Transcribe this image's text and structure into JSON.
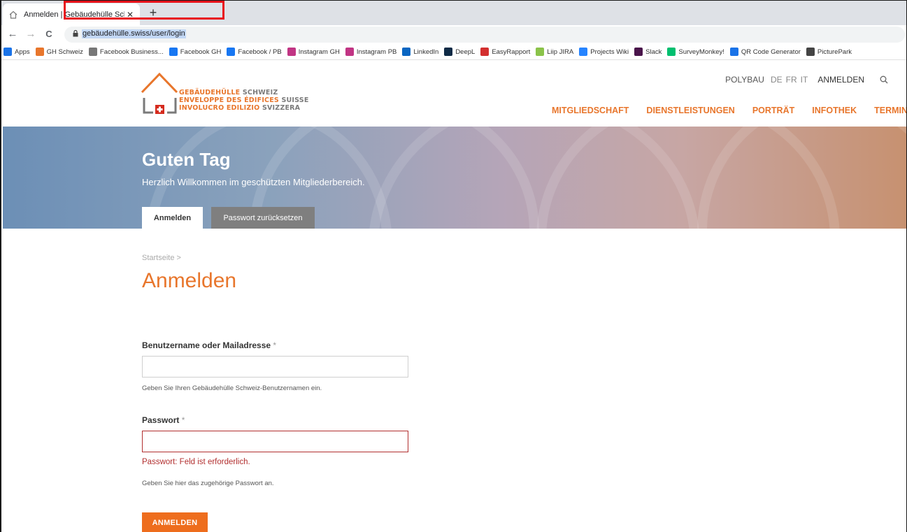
{
  "browser": {
    "tab_title": "Anmelden | Gebäudehülle Schwe",
    "tab_close": "✕",
    "new_tab": "+",
    "url": "gebäudehülle.swiss/user/login",
    "back": "←",
    "forward": "→",
    "reload": "C"
  },
  "bookmarks": [
    {
      "label": "Apps",
      "color": "#1a73e8"
    },
    {
      "label": "GH Schweiz",
      "color": "#e8762c"
    },
    {
      "label": "Facebook Business...",
      "color": "#777777"
    },
    {
      "label": "Facebook GH",
      "color": "#1877f2"
    },
    {
      "label": "Facebook / PB",
      "color": "#1877f2"
    },
    {
      "label": "Instagram GH",
      "color": "#c13584"
    },
    {
      "label": "Instagram PB",
      "color": "#c13584"
    },
    {
      "label": "LinkedIn",
      "color": "#0a66c2"
    },
    {
      "label": "DeepL",
      "color": "#0f2b46"
    },
    {
      "label": "EasyRapport",
      "color": "#d32f2f"
    },
    {
      "label": "Liip JIRA",
      "color": "#8bc34a"
    },
    {
      "label": "Projects Wiki",
      "color": "#2684ff"
    },
    {
      "label": "Slack",
      "color": "#4a154b"
    },
    {
      "label": "SurveyMonkey!",
      "color": "#00bf6f"
    },
    {
      "label": "QR Code Generator",
      "color": "#1a73e8"
    },
    {
      "label": "PicturePark",
      "color": "#444444"
    }
  ],
  "site": {
    "logo_lines": [
      {
        "orange": "GEBÄUDEHÜLLE",
        "grey": " SCHWEIZ"
      },
      {
        "orange": "ENVELOPPE DES ÉDIFICES",
        "grey": " SUISSE"
      },
      {
        "orange": "INVOLUCRO EDILIZIO",
        "grey": " SVIZZERA"
      }
    ],
    "topnav": {
      "polybau": "POLYBAU",
      "de": "DE",
      "fr": "FR",
      "it": "IT",
      "login": "ANMELDEN"
    },
    "mainnav": [
      "MITGLIEDSCHAFT",
      "DIENSTLEISTUNGEN",
      "PORTRÄT",
      "INFOTHEK",
      "TERMINE"
    ],
    "accent": "#e8762c"
  },
  "hero": {
    "title": "Guten Tag",
    "subtitle": "Herzlich Willkommen im geschützten Mitgliederbereich.",
    "tab_login": "Anmelden",
    "tab_reset": "Passwort zurücksetzen"
  },
  "content": {
    "breadcrumb": "Startseite >",
    "title": "Anmelden",
    "username_label": "Benutzername oder Mailadresse",
    "required_mark": "*",
    "username_value": "",
    "username_help": "Geben Sie Ihren Gebäudehülle Schweiz-Benutzernamen ein.",
    "password_label": "Passwort",
    "password_value": "",
    "password_error": "Passwort: Feld ist erforderlich.",
    "password_help": "Geben Sie hier das zugehörige Passwort an.",
    "submit_label": "ANMELDEN"
  }
}
